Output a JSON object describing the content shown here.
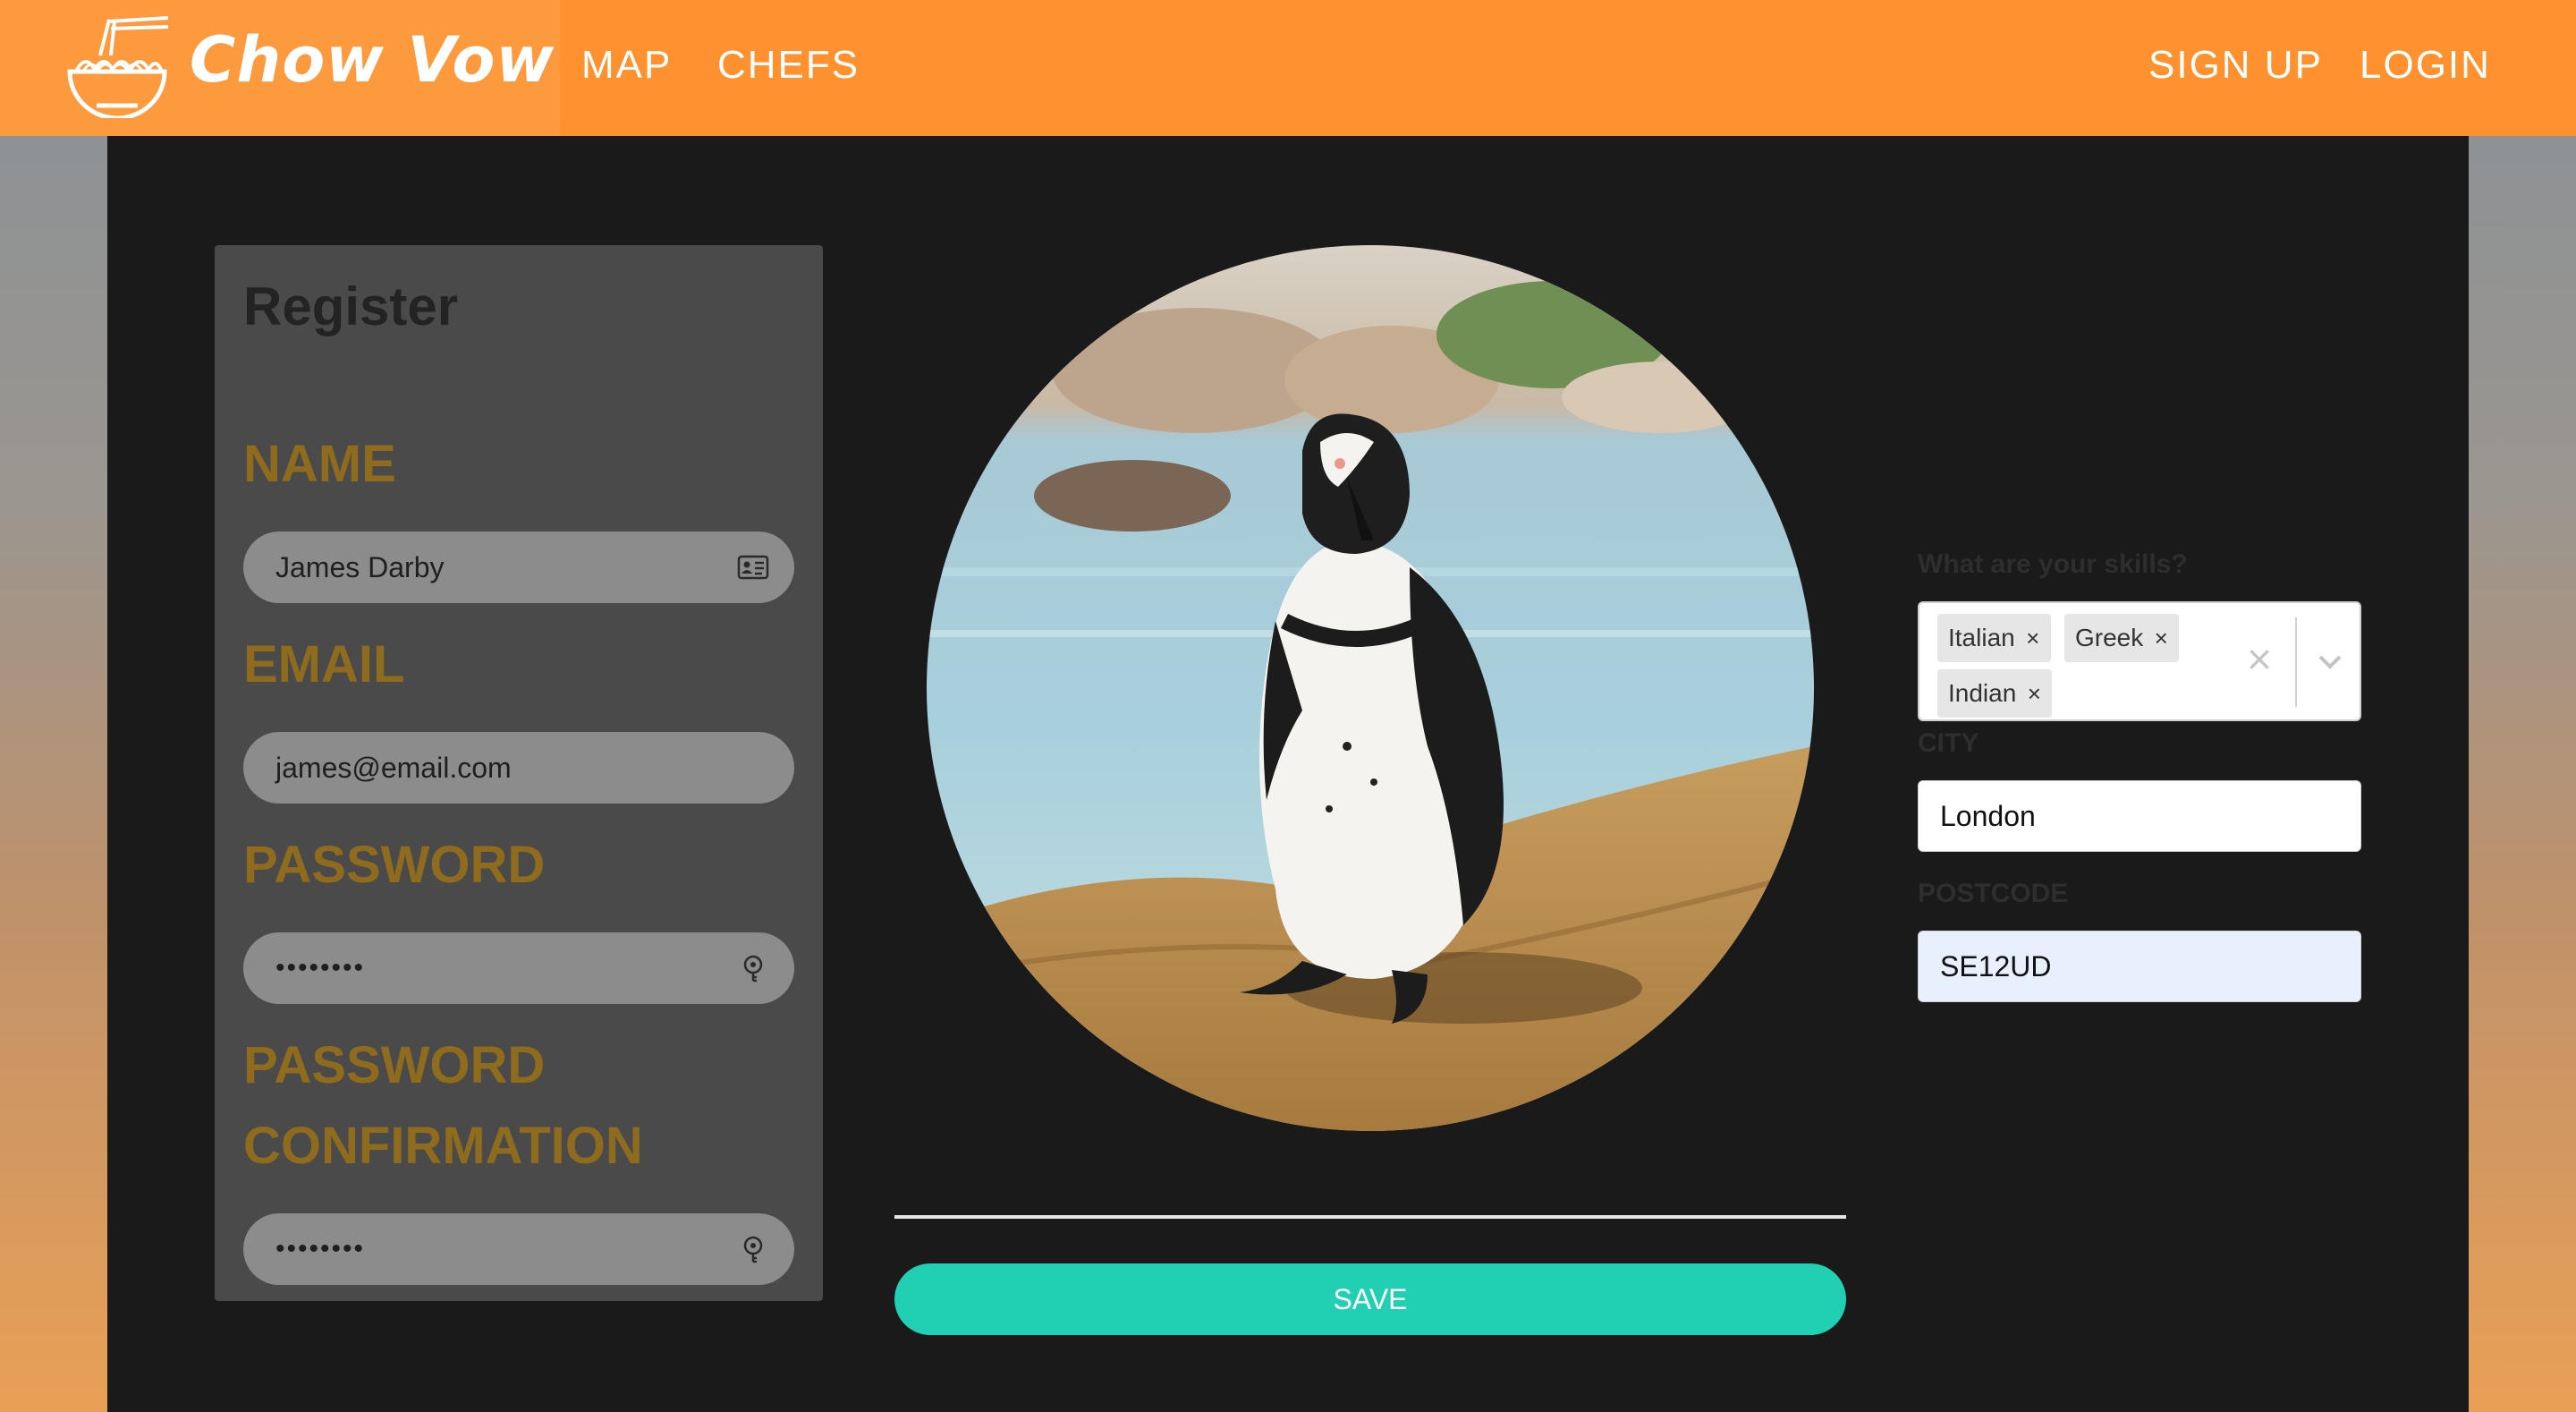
{
  "navbar": {
    "brand": "Chow Vow",
    "links": {
      "map": "MAP",
      "chefs": "CHEFS",
      "sign_up": "SIGN UP",
      "login": "LOGIN"
    }
  },
  "register": {
    "title": "Register",
    "name_label": "NAME",
    "name_value": "James Darby",
    "email_label": "EMAIL",
    "email_value": "james@email.com",
    "password_label": "PASSWORD",
    "password_value": "••••••••",
    "confirm_label_line1": "PASSWORD",
    "confirm_label_line2": "CONFIRMATION",
    "confirm_value": "••••••••"
  },
  "avatar": {
    "description_icon": "penguin-photo"
  },
  "save_button": "SAVE",
  "skills": {
    "label": "What are your skills?",
    "selected": [
      "Italian",
      "Greek",
      "Indian"
    ],
    "remove_glyph": "×",
    "clear_glyph": "×"
  },
  "city": {
    "label": "CITY",
    "value": "London"
  },
  "postcode": {
    "label": "POSTCODE",
    "value": "SE12UD"
  },
  "colors": {
    "nav": "#ff922e",
    "label_gold": "#8e6b1d",
    "save": "#21d0b2",
    "autofill": "#e8f0fe"
  }
}
